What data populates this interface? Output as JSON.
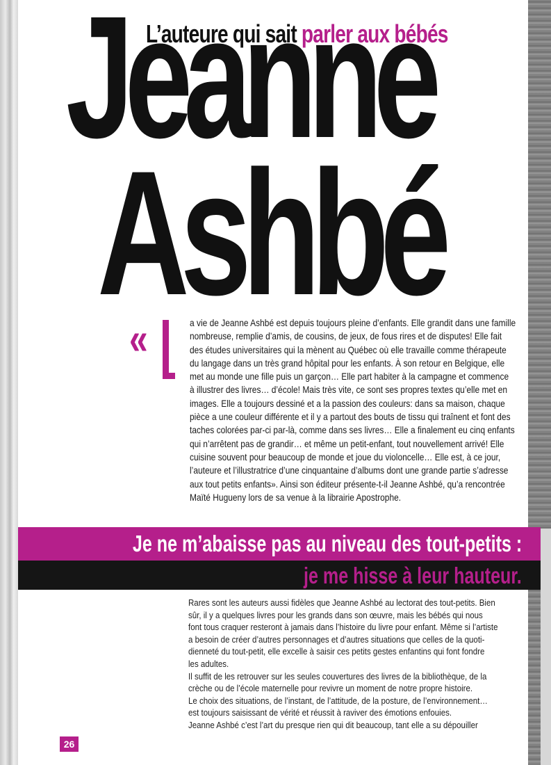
{
  "header": {
    "eyebrow_dark": "L’auteure qui sait",
    "eyebrow_pink": "parler aux bébés",
    "title_line1": "Jeanne",
    "title_line2": "Ashbé"
  },
  "intro": {
    "open_quote": "«",
    "lines": [
      "a vie de Jeanne Ashbé est depuis toujours pleine d’enfants. Elle grandit dans une famille",
      "nombreuse, remplie d’amis, de cousins, de jeux, de fous rires et de disputes! Elle fait",
      "des études universitaires qui la mènent au Québec où elle travaille comme thérapeute",
      "du langage dans un très grand hôpital pour les enfants. À son retour en Belgique, elle",
      "met au monde une fille puis un garçon… Elle part habiter à la campagne et commence",
      "à illustrer des livres… d’école! Mais très vite, ce sont ses propres textes qu’elle met en",
      "images. Elle a toujours dessiné et a la passion des couleurs: dans sa maison, chaque",
      "pièce a une couleur différente et il y a partout des bouts de tissu qui traînent et font des",
      "taches colorées par-ci par-là, comme dans ses livres… Elle a finalement eu cinq enfants",
      "qui n’arrêtent pas de grandir… et même un petit-enfant, tout nouvellement arrivé! Elle",
      "cuisine souvent pour beaucoup de monde et joue du violoncelle… Elle est, à ce jour,",
      "l’auteure et l’illustratrice d’une cinquantaine d’albums dont une grande partie s’adresse",
      "aux tout petits enfants». Ainsi son éditeur présente-t-il Jeanne Ashbé, qu’a rencontrée",
      "Maïté Hugueny lors de sa venue à la librairie Apostrophe."
    ]
  },
  "pullquote": {
    "line1": "Je ne m’abaisse pas au niveau des tout-petits :",
    "line2": "je me hisse à leur hauteur."
  },
  "body": {
    "lines": [
      "Rares sont les auteurs aussi fidèles que Jeanne Ashbé au lectorat des tout-petits. Bien",
      "sûr, il y a quelques livres pour les grands dans son œuvre, mais les bébés qui nous",
      "font tous craquer resteront à jamais dans l’histoire du livre pour enfant. Même si l’artiste",
      "a besoin de créer d’autres personnages et d’autres situations que celles de la quoti-",
      "dienneté du tout-petit, elle excelle à saisir ces petits gestes enfantins qui font fondre",
      "les adultes.",
      "Il suffit de les retrouver sur les seules couvertures des livres de la bibliothèque, de la",
      "crèche ou de l’école maternelle pour revivre un moment de notre propre histoire.",
      "Le choix des situations, de l’instant, de l’attitude, de la posture, de l’environnement…",
      "est toujours saisissant de vérité et réussit à raviver des émotions enfouies.",
      "Jeanne Ashbé c’est l’art du presque rien qui dit beaucoup, tant elle a su dépouiller"
    ]
  },
  "footer": {
    "page_number": "26"
  },
  "colors": {
    "accent": "#b51f8b",
    "text": "#111111",
    "band_dark": "#151515"
  }
}
